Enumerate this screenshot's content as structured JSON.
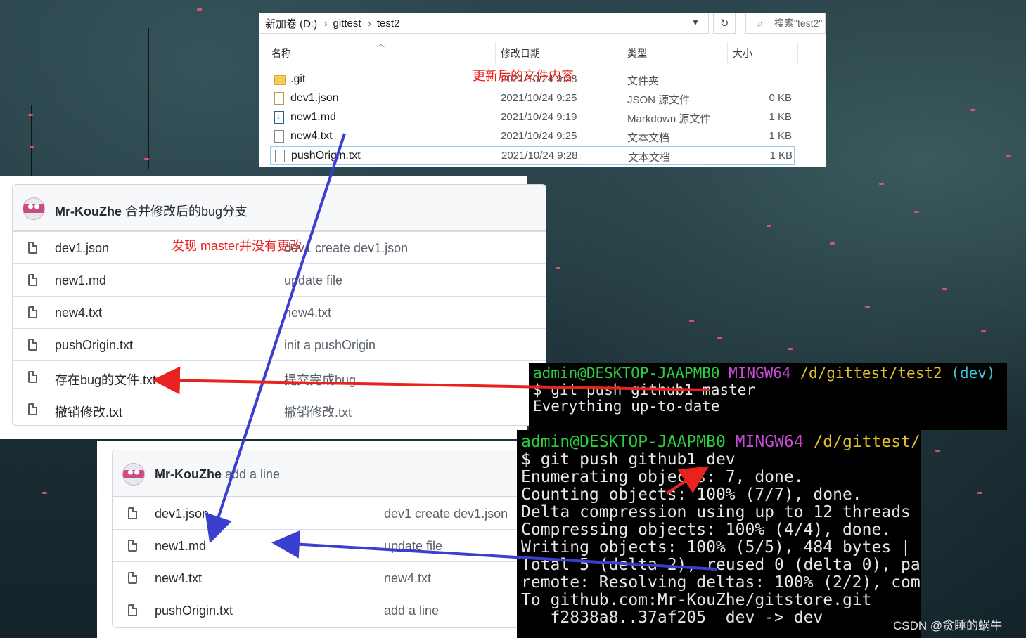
{
  "explorer": {
    "breadcrumb": [
      "新加卷 (D:)",
      "gittest",
      "test2"
    ],
    "search_placeholder": "搜索\"test2\"",
    "columns": [
      "名称",
      "修改日期",
      "类型",
      "大小"
    ],
    "files": [
      {
        "name": ".git",
        "date": "2021/10/24 9:28",
        "type": "文件夹",
        "size": "",
        "icon": "folder-icon"
      },
      {
        "name": "dev1.json",
        "date": "2021/10/24 9:25",
        "type": "JSON 源文件",
        "size": "0 KB",
        "icon": "json-file-icon"
      },
      {
        "name": "new1.md",
        "date": "2021/10/24 9:19",
        "type": "Markdown 源文件",
        "size": "1 KB",
        "icon": "markdown-file-icon"
      },
      {
        "name": "new4.txt",
        "date": "2021/10/24 9:25",
        "type": "文本文档",
        "size": "1 KB",
        "icon": "text-file-icon"
      },
      {
        "name": "pushOrigin.txt",
        "date": "2021/10/24 9:28",
        "type": "文本文档",
        "size": "1 KB",
        "icon": "text-file-icon"
      }
    ]
  },
  "annotations": {
    "explorer_note": "更新后的文件内容",
    "master_note": "发现 master并没有更改"
  },
  "repo_master": {
    "author": "Mr-KouZhe",
    "commit_message": "合并修改后的bug分支",
    "files": [
      {
        "name": "dev1.json",
        "commit": "dev1 create dev1.json"
      },
      {
        "name": "new1.md",
        "commit": "update file"
      },
      {
        "name": "new4.txt",
        "commit": "new4.txt"
      },
      {
        "name": "pushOrigin.txt",
        "commit": "init a pushOrigin"
      },
      {
        "name": "存在bug的文件.txt",
        "commit": "提交完成bug"
      },
      {
        "name": "撤销修改.txt",
        "commit": "撤销修改.txt"
      }
    ]
  },
  "repo_dev": {
    "author": "Mr-KouZhe",
    "commit_message": "add a line",
    "files": [
      {
        "name": "dev1.json",
        "commit": "dev1 create dev1.json"
      },
      {
        "name": "new1.md",
        "commit": "update file"
      },
      {
        "name": "new4.txt",
        "commit": "new4.txt"
      },
      {
        "name": "pushOrigin.txt",
        "commit": "add a line"
      }
    ]
  },
  "terminal_master": {
    "prompt_user": "admin@DESKTOP-JAAPMB0",
    "prompt_env": "MINGW64",
    "prompt_path": "/d/gittest/test2",
    "prompt_branch": "(dev)",
    "command": "$ git push github1 master",
    "output": "Everything up-to-date"
  },
  "terminal_dev": {
    "prompt_user": "admin@DESKTOP-JAAPMB0",
    "prompt_env": "MINGW64",
    "prompt_path": "/d/gittest/",
    "command": "$ git push github1 dev",
    "output": [
      "Enumerating objects: 7, done.",
      "Counting objects: 100% (7/7), done.",
      "Delta compression using up to 12 threads",
      "Compressing objects: 100% (4/4), done.",
      "Writing objects: 100% (5/5), 484 bytes |",
      "Total 5 (delta 2), reused 0 (delta 0), pa",
      "remote: Resolving deltas: 100% (2/2), com",
      "To github.com:Mr-KouZhe/gitstore.git",
      "   f2838a8..37af205  dev -> dev"
    ]
  },
  "watermark": "CSDN @贪睡的蜗牛",
  "colors": {
    "annotation_red": "#e8231f",
    "arrow_blue": "#3a3fcf",
    "arrow_red": "#e8231f",
    "term_green": "#2ecc40",
    "term_magenta": "#c84bd6",
    "term_yellow": "#e0c02a",
    "term_cyan": "#3cc6d8"
  }
}
